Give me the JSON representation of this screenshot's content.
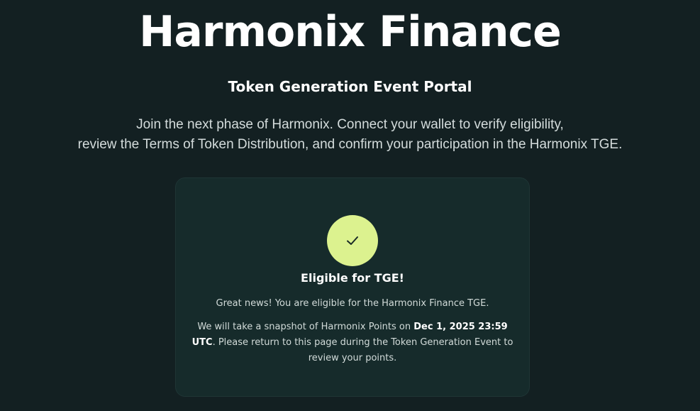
{
  "hero": {
    "title": "Harmonix Finance",
    "subtitle": "Token Generation Event Portal",
    "description_line1": "Join the next phase of Harmonix. Connect your wallet to verify eligibility,",
    "description_line2": "review the Terms of Token Distribution, and confirm your participation in the Harmonix TGE."
  },
  "status_card": {
    "icon": "check-icon",
    "title": "Eligible for TGE!",
    "message": "Great news! You are eligible for the Harmonix Finance TGE.",
    "snapshot_prefix": "We will take a snapshot of Harmonix Points on ",
    "snapshot_date": "Dec 1, 2025 23:59 UTC",
    "snapshot_suffix": ". Please return to this page during the Token Generation Event to review your points."
  },
  "colors": {
    "background": "#132022",
    "card_background": "#162b2b",
    "accent": "#dcf28f",
    "text_primary": "#ffffff",
    "text_secondary": "#d2dbd9"
  }
}
